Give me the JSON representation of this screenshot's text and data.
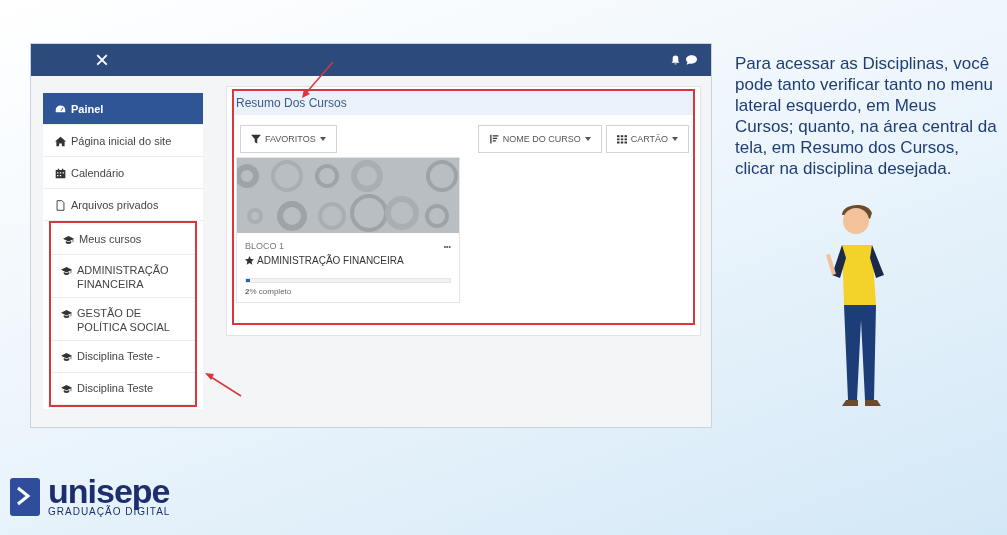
{
  "app": {
    "topbar": {
      "close": "×"
    },
    "sidebar": {
      "items": [
        {
          "label": "Painel",
          "kind": "dashboard",
          "selected": true
        },
        {
          "label": "Página inicial do site",
          "kind": "home",
          "selected": false
        },
        {
          "label": "Calendário",
          "kind": "calendar",
          "selected": false
        },
        {
          "label": "Arquivos privados",
          "kind": "file",
          "selected": false
        },
        {
          "label": "Meus cursos",
          "kind": "course",
          "selected": false,
          "annotated": true,
          "children": [
            {
              "label": "ADMINISTRAÇÃO FINANCEIRA",
              "kind": "course",
              "selected": false
            },
            {
              "label": "GESTÃO DE POLÍTICA SOCIAL",
              "kind": "course",
              "selected": false
            },
            {
              "label": "Disciplina Teste -",
              "kind": "course",
              "selected": false
            },
            {
              "label": "Disciplina Teste",
              "kind": "course",
              "selected": false
            }
          ]
        }
      ]
    },
    "course_overview": {
      "title": "Resumo Dos Cursos",
      "annotated": true,
      "filters": [
        {
          "label": "FAVORITOS",
          "kind": "filter"
        },
        {
          "label": "NOME DO CURSO",
          "kind": "sort"
        },
        {
          "label": "CARTÃO",
          "kind": "grid"
        }
      ],
      "courses": [
        {
          "category": "BLOCO 1",
          "menu": "•••",
          "title": "ADMINISTRAÇÃO FINANCEIRA",
          "starred": true,
          "level": 0.02,
          "progress_text": "**2**% completo"
        }
      ]
    }
  },
  "caption": "Para acessar as Disciplinas, você pode tanto verificar tanto no menu lateral esquerdo, em Meus Cursos; quanto, na área central da tela, em Resumo dos Cursos, clicar na disciplina desejada.",
  "logo": {
    "name": "unisepe",
    "tagline": "GRADUAÇÃO DIGITAL"
  }
}
